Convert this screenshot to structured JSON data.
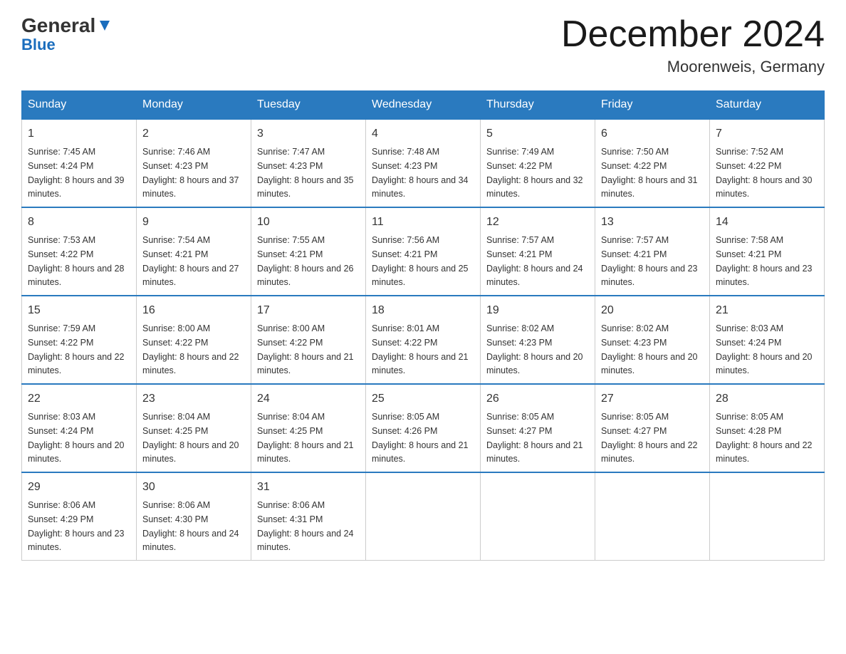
{
  "header": {
    "logo_general": "General",
    "logo_blue": "Blue",
    "month_title": "December 2024",
    "location": "Moorenweis, Germany"
  },
  "weekdays": [
    "Sunday",
    "Monday",
    "Tuesday",
    "Wednesday",
    "Thursday",
    "Friday",
    "Saturday"
  ],
  "weeks": [
    [
      {
        "day": "1",
        "sunrise": "7:45 AM",
        "sunset": "4:24 PM",
        "daylight": "8 hours and 39 minutes."
      },
      {
        "day": "2",
        "sunrise": "7:46 AM",
        "sunset": "4:23 PM",
        "daylight": "8 hours and 37 minutes."
      },
      {
        "day": "3",
        "sunrise": "7:47 AM",
        "sunset": "4:23 PM",
        "daylight": "8 hours and 35 minutes."
      },
      {
        "day": "4",
        "sunrise": "7:48 AM",
        "sunset": "4:23 PM",
        "daylight": "8 hours and 34 minutes."
      },
      {
        "day": "5",
        "sunrise": "7:49 AM",
        "sunset": "4:22 PM",
        "daylight": "8 hours and 32 minutes."
      },
      {
        "day": "6",
        "sunrise": "7:50 AM",
        "sunset": "4:22 PM",
        "daylight": "8 hours and 31 minutes."
      },
      {
        "day": "7",
        "sunrise": "7:52 AM",
        "sunset": "4:22 PM",
        "daylight": "8 hours and 30 minutes."
      }
    ],
    [
      {
        "day": "8",
        "sunrise": "7:53 AM",
        "sunset": "4:22 PM",
        "daylight": "8 hours and 28 minutes."
      },
      {
        "day": "9",
        "sunrise": "7:54 AM",
        "sunset": "4:21 PM",
        "daylight": "8 hours and 27 minutes."
      },
      {
        "day": "10",
        "sunrise": "7:55 AM",
        "sunset": "4:21 PM",
        "daylight": "8 hours and 26 minutes."
      },
      {
        "day": "11",
        "sunrise": "7:56 AM",
        "sunset": "4:21 PM",
        "daylight": "8 hours and 25 minutes."
      },
      {
        "day": "12",
        "sunrise": "7:57 AM",
        "sunset": "4:21 PM",
        "daylight": "8 hours and 24 minutes."
      },
      {
        "day": "13",
        "sunrise": "7:57 AM",
        "sunset": "4:21 PM",
        "daylight": "8 hours and 23 minutes."
      },
      {
        "day": "14",
        "sunrise": "7:58 AM",
        "sunset": "4:21 PM",
        "daylight": "8 hours and 23 minutes."
      }
    ],
    [
      {
        "day": "15",
        "sunrise": "7:59 AM",
        "sunset": "4:22 PM",
        "daylight": "8 hours and 22 minutes."
      },
      {
        "day": "16",
        "sunrise": "8:00 AM",
        "sunset": "4:22 PM",
        "daylight": "8 hours and 22 minutes."
      },
      {
        "day": "17",
        "sunrise": "8:00 AM",
        "sunset": "4:22 PM",
        "daylight": "8 hours and 21 minutes."
      },
      {
        "day": "18",
        "sunrise": "8:01 AM",
        "sunset": "4:22 PM",
        "daylight": "8 hours and 21 minutes."
      },
      {
        "day": "19",
        "sunrise": "8:02 AM",
        "sunset": "4:23 PM",
        "daylight": "8 hours and 20 minutes."
      },
      {
        "day": "20",
        "sunrise": "8:02 AM",
        "sunset": "4:23 PM",
        "daylight": "8 hours and 20 minutes."
      },
      {
        "day": "21",
        "sunrise": "8:03 AM",
        "sunset": "4:24 PM",
        "daylight": "8 hours and 20 minutes."
      }
    ],
    [
      {
        "day": "22",
        "sunrise": "8:03 AM",
        "sunset": "4:24 PM",
        "daylight": "8 hours and 20 minutes."
      },
      {
        "day": "23",
        "sunrise": "8:04 AM",
        "sunset": "4:25 PM",
        "daylight": "8 hours and 20 minutes."
      },
      {
        "day": "24",
        "sunrise": "8:04 AM",
        "sunset": "4:25 PM",
        "daylight": "8 hours and 21 minutes."
      },
      {
        "day": "25",
        "sunrise": "8:05 AM",
        "sunset": "4:26 PM",
        "daylight": "8 hours and 21 minutes."
      },
      {
        "day": "26",
        "sunrise": "8:05 AM",
        "sunset": "4:27 PM",
        "daylight": "8 hours and 21 minutes."
      },
      {
        "day": "27",
        "sunrise": "8:05 AM",
        "sunset": "4:27 PM",
        "daylight": "8 hours and 22 minutes."
      },
      {
        "day": "28",
        "sunrise": "8:05 AM",
        "sunset": "4:28 PM",
        "daylight": "8 hours and 22 minutes."
      }
    ],
    [
      {
        "day": "29",
        "sunrise": "8:06 AM",
        "sunset": "4:29 PM",
        "daylight": "8 hours and 23 minutes."
      },
      {
        "day": "30",
        "sunrise": "8:06 AM",
        "sunset": "4:30 PM",
        "daylight": "8 hours and 24 minutes."
      },
      {
        "day": "31",
        "sunrise": "8:06 AM",
        "sunset": "4:31 PM",
        "daylight": "8 hours and 24 minutes."
      },
      null,
      null,
      null,
      null
    ]
  ]
}
